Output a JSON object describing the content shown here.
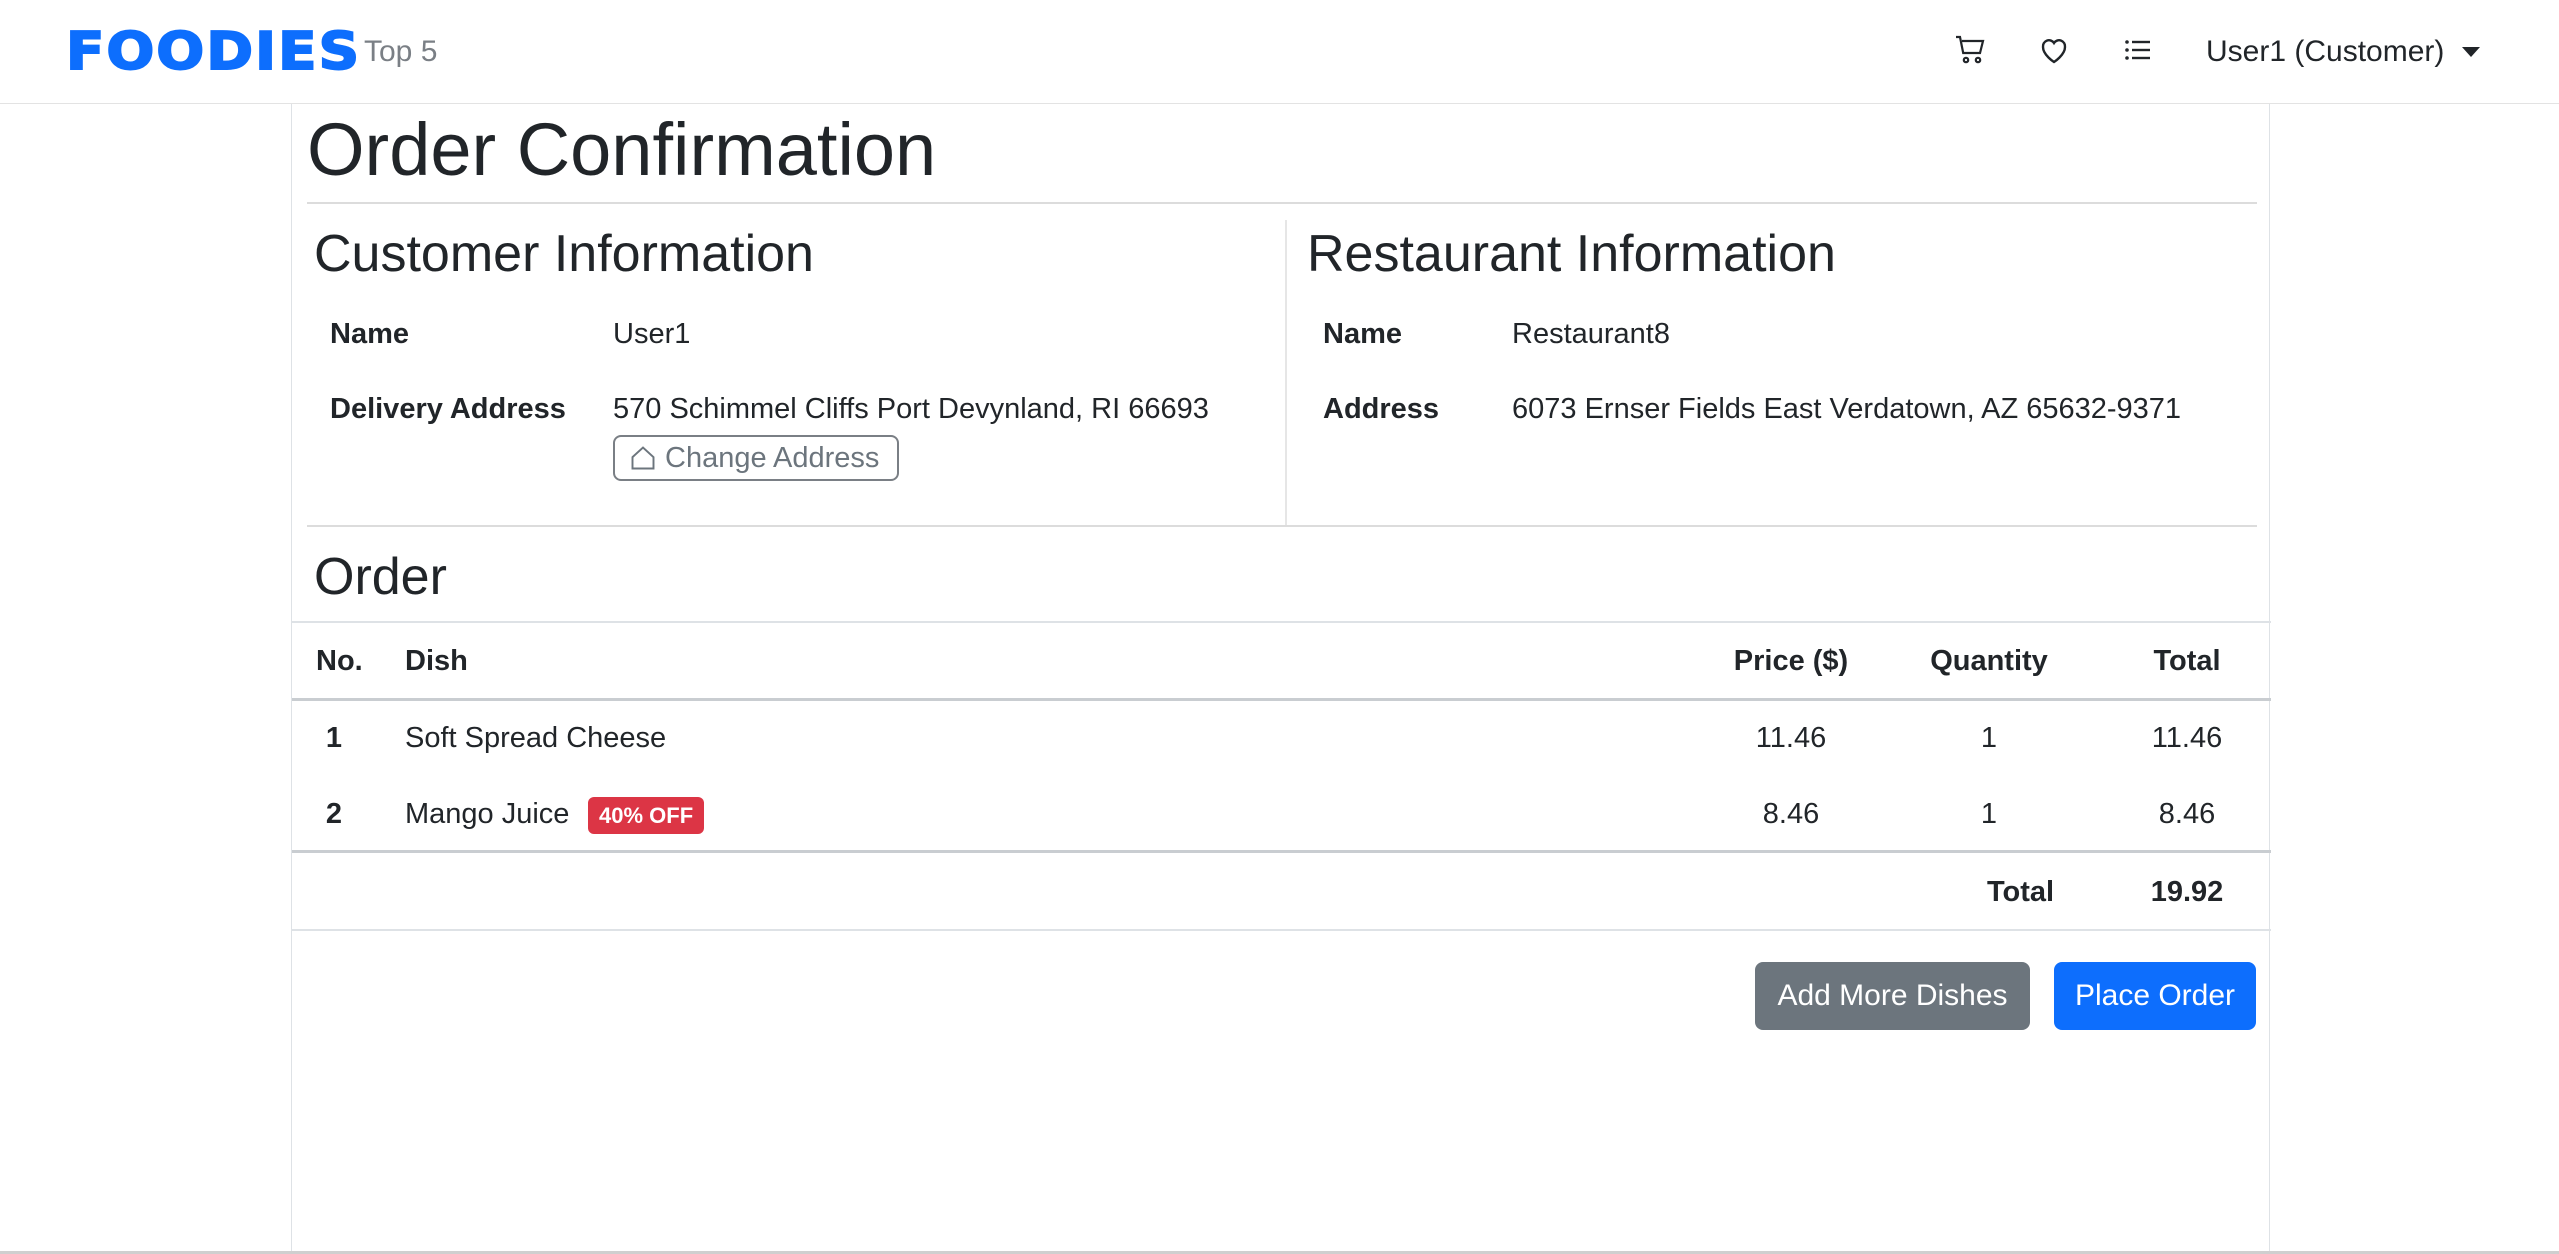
{
  "navbar": {
    "brand": "FOODIES",
    "top5_label": "Top 5",
    "icons": [
      "cart-icon",
      "heart-icon",
      "list-icon"
    ],
    "user_label": "User1 (Customer)"
  },
  "page": {
    "title": "Order Confirmation"
  },
  "customer": {
    "heading": "Customer Information",
    "name_label": "Name",
    "name_value": "User1",
    "address_label": "Delivery Address",
    "address_value": "570 Schimmel Cliffs Port Devynland, RI 66693",
    "change_address_label": "Change Address"
  },
  "restaurant": {
    "heading": "Restaurant Information",
    "name_label": "Name",
    "name_value": "Restaurant8",
    "address_label": "Address",
    "address_value": "6073 Ernser Fields East Verdatown, AZ 65632-9371"
  },
  "order": {
    "heading": "Order",
    "columns": {
      "no": "No.",
      "dish": "Dish",
      "price": "Price ($)",
      "quantity": "Quantity",
      "total": "Total"
    },
    "rows": [
      {
        "no": "1",
        "dish": "Soft Spread Cheese",
        "badge": "",
        "price": "11.46",
        "quantity": "1",
        "total": "11.46"
      },
      {
        "no": "2",
        "dish": "Mango Juice",
        "badge": "40% OFF",
        "price": "8.46",
        "quantity": "1",
        "total": "8.46"
      }
    ],
    "total_label": "Total",
    "total_value": "19.92"
  },
  "actions": {
    "add_more_label": "Add More Dishes",
    "place_order_label": "Place Order"
  },
  "colors": {
    "primary": "#0d6efd",
    "secondary": "#6c757d",
    "danger": "#dc3545"
  }
}
